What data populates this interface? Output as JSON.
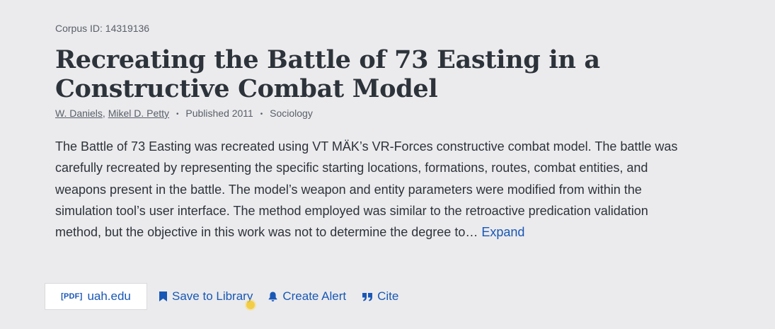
{
  "corpus": {
    "label": "Corpus ID: 14319136"
  },
  "title": "Recreating the Battle of 73 Easting in a Constructive Combat Model",
  "meta": {
    "authors": [
      "W. Daniels",
      "Mikel D. Petty"
    ],
    "author_separator": ",",
    "published": "Published 2011",
    "field": "Sociology",
    "dot": "•"
  },
  "abstract": {
    "text": "The Battle of 73 Easting was recreated using VT MÄK’s VR-Forces constructive combat model. The battle was carefully recreated by representing the specific starting locations, formations, routes, combat entities, and weapons present in the battle. The model’s weapon and entity parameters were modified from within the simulation tool’s user interface. The method employed was similar to the retroactive predication validation method, but the objective in this work was not to determine the degree to…",
    "expand_label": "Expand"
  },
  "actions": {
    "pdf_tag": "[PDF]",
    "pdf_host": "uah.edu",
    "save_label": "Save to Library",
    "alert_label": "Create Alert",
    "cite_label": "Cite"
  },
  "colors": {
    "background": "#ebebed",
    "link": "#1857b6",
    "title": "#2d333a",
    "muted": "#595f69"
  }
}
